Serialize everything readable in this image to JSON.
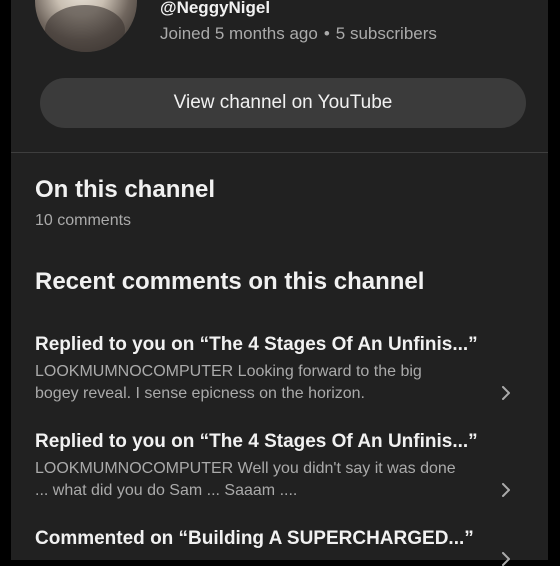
{
  "channel": {
    "handle": "@NeggyNigel",
    "joined": "Joined 5 months ago",
    "separator": "•",
    "subscribers": "5 subscribers",
    "view_button": "View channel on YouTube"
  },
  "on_channel": {
    "title": "On this channel",
    "count": "10 comments"
  },
  "recent": {
    "title": "Recent comments on this channel",
    "items": [
      {
        "heading": "Replied to you on “The 4 Stages Of An Unfinis...”",
        "line1": "LOOKMUMNOCOMPUTER Looking forward to the big",
        "line2": "bogey reveal. I sense epicness on the horizon."
      },
      {
        "heading": "Replied to you on “The 4 Stages Of An Unfinis...”",
        "line1": "LOOKMUMNOCOMPUTER Well you didn't say it was done",
        "line2": "... what did you do Sam ... Saaam ...."
      },
      {
        "heading": "Commented on “Building A SUPERCHARGED...”",
        "line1": "",
        "line2": ""
      }
    ]
  },
  "icons": {
    "chevron": "chevron-right-icon"
  }
}
